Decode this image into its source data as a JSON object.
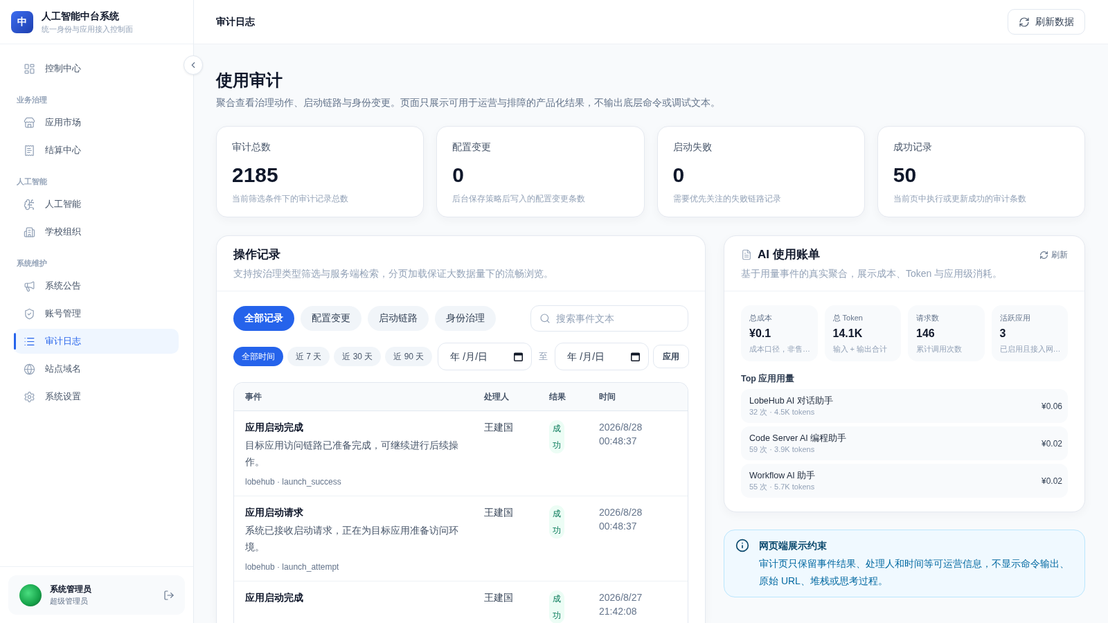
{
  "sidebar": {
    "brand": {
      "logo": "中",
      "title": "人工智能中台系统",
      "subtitle": "统一身份与应用接入控制面"
    },
    "nav": [
      {
        "kind": "item",
        "label": "控制中心",
        "selected": false
      },
      {
        "kind": "section",
        "label": "业务治理"
      },
      {
        "kind": "item",
        "label": "应用市场",
        "selected": false
      },
      {
        "kind": "item",
        "label": "结算中心",
        "selected": false
      },
      {
        "kind": "section",
        "label": "人工智能"
      },
      {
        "kind": "item",
        "label": "人工智能",
        "selected": false
      },
      {
        "kind": "item",
        "label": "学校组织",
        "selected": false
      },
      {
        "kind": "section",
        "label": "系统维护"
      },
      {
        "kind": "item",
        "label": "系统公告",
        "selected": false
      },
      {
        "kind": "item",
        "label": "账号管理",
        "selected": false
      },
      {
        "kind": "item",
        "label": "审计日志",
        "selected": true
      },
      {
        "kind": "item",
        "label": "站点域名",
        "selected": false
      },
      {
        "kind": "item",
        "label": "系统设置",
        "selected": false
      }
    ],
    "user": {
      "name": "系统管理员",
      "role": "超级管理员"
    }
  },
  "topbar": {
    "title": "审计日志",
    "refresh_button": "刷新数据"
  },
  "page": {
    "title": "使用审计",
    "description": "聚合查看治理动作、启动链路与身份变更。页面只展示可用于运营与排障的产品化结果，不输出底层命令或调试文本。"
  },
  "stats": [
    {
      "label": "审计总数",
      "value": "2185",
      "caption": "当前筛选条件下的审计记录总数"
    },
    {
      "label": "配置变更",
      "value": "0",
      "caption": "后台保存策略后写入的配置变更条数"
    },
    {
      "label": "启动失败",
      "value": "0",
      "caption": "需要优先关注的失败链路记录"
    },
    {
      "label": "成功记录",
      "value": "50",
      "caption": "当前页中执行或更新成功的审计条数"
    }
  ],
  "records": {
    "title": "操作记录",
    "description": "支持按治理类型筛选与服务端检索，分页加载保证大数据量下的流畅浏览。",
    "type_filters": [
      {
        "label": "全部记录",
        "selected": true
      },
      {
        "label": "配置变更",
        "selected": false
      },
      {
        "label": "启动链路",
        "selected": false
      },
      {
        "label": "身份治理",
        "selected": false
      }
    ],
    "search": {
      "placeholder": "搜索事件文本"
    },
    "time_filters": [
      {
        "label": "全部时间",
        "selected": true
      },
      {
        "label": "近 7 天",
        "selected": false
      },
      {
        "label": "近 30 天",
        "selected": false
      },
      {
        "label": "近 90 天",
        "selected": false
      }
    ],
    "date_range": {
      "start_placeholder": "年 /月/日",
      "separator": "至",
      "end_placeholder": "年 /月/日"
    },
    "apply_button": "应用",
    "table": {
      "columns": [
        "事件",
        "处理人",
        "结果",
        "时间"
      ],
      "rows": [
        {
          "event": "应用启动完成",
          "description": "目标应用访问链路已准备完成，可继续进行后续操作。",
          "meta": "lobehub · launch_success",
          "handler": "王建国",
          "result": "成功",
          "succeeded": true,
          "time": "2026/8/28 00:48:37"
        },
        {
          "event": "应用启动请求",
          "description": "系统已接收启动请求，正在为目标应用准备访问环境。",
          "meta": "lobehub · launch_attempt",
          "handler": "王建国",
          "result": "成功",
          "succeeded": true,
          "time": "2026/8/28 00:48:37"
        },
        {
          "event": "应用启动完成",
          "handler": "王建国",
          "result": "成功",
          "succeeded": true,
          "time": "2026/8/27 21:42:08"
        }
      ]
    }
  },
  "billing": {
    "title": "AI 使用账单",
    "refresh_button": "刷新",
    "description": "基于用量事件的真实聚合，展示成本、Token 与应用级消耗。",
    "metrics": [
      {
        "label": "总成本",
        "value": "¥0.1",
        "caption": "成本口径，非售…"
      },
      {
        "label": "总 Token",
        "value": "14.1K",
        "caption": "输入 + 输出合计"
      },
      {
        "label": "请求数",
        "value": "146",
        "caption": "累计调用次数"
      },
      {
        "label": "活跃应用",
        "value": "3",
        "caption": "已启用且接入网…"
      }
    ],
    "top_title": "Top 应用用量",
    "top_apps": [
      {
        "name": "LobeHub AI 对话助手",
        "usage": "32 次 · 4.5K tokens",
        "cost": "¥0.06"
      },
      {
        "name": "Code Server AI 编程助手",
        "usage": "59 次 · 3.9K tokens",
        "cost": "¥0.02"
      },
      {
        "name": "Workflow AI 助手",
        "usage": "55 次 · 5.7K tokens",
        "cost": "¥0.02"
      }
    ]
  },
  "notice": {
    "title": "网页端展示约束",
    "body": "审计页只保留事件结果、处理人和时间等可运营信息，不显示命令输出、原始 URL、堆栈或思考过程。"
  }
}
